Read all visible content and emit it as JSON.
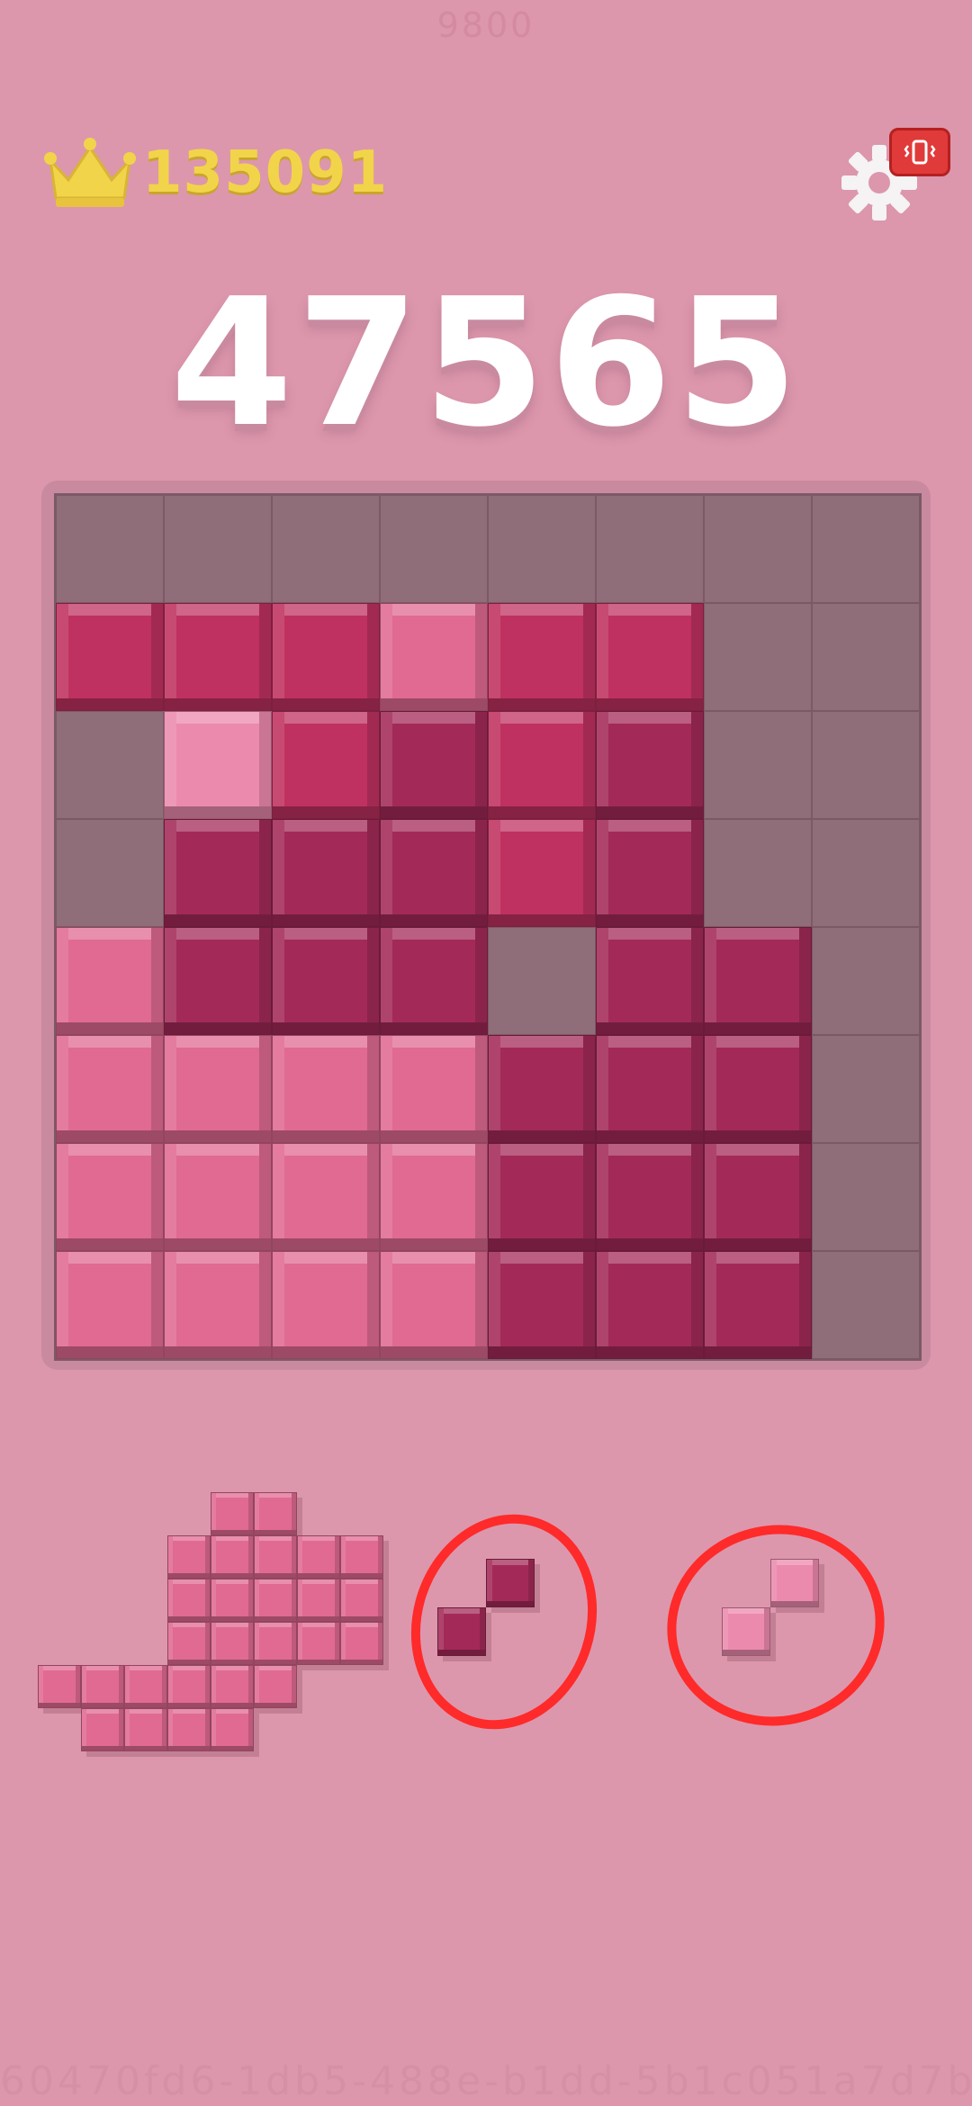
{
  "watermark": {
    "top": "9800",
    "bottom": "60470fd6-1db5-488e-b1dd-5b1c051a7d7b"
  },
  "header": {
    "best_score": "135091",
    "best_icon": "crown-icon",
    "settings_icon": "gear-icon",
    "vibration_icon": "vibration-icon"
  },
  "score": "47565",
  "colors": {
    "background": "#dc97ac",
    "empty": "#8f6e7a",
    "light": "#e06a92",
    "mid": "#bf3160",
    "dark": "#a32a58",
    "pale": "#ec8aad",
    "highlight_circle": "#ff2a2a"
  },
  "board": {
    "size": 8,
    "rows": [
      "........",
      "MMMLMM..",
      ".PMDMD..",
      ".DDDMD..",
      "LDDD.DD.",
      "LLLLDDD.",
      "LLLLDDD.",
      "LLLLDDD."
    ]
  },
  "pieces": [
    {
      "name": "big-piece",
      "color": "light",
      "cells": [
        [
          4,
          0
        ],
        [
          5,
          0
        ],
        [
          3,
          1
        ],
        [
          4,
          1
        ],
        [
          5,
          1
        ],
        [
          6,
          1
        ],
        [
          7,
          1
        ],
        [
          3,
          2
        ],
        [
          4,
          2
        ],
        [
          5,
          2
        ],
        [
          6,
          2
        ],
        [
          7,
          2
        ],
        [
          3,
          3
        ],
        [
          4,
          3
        ],
        [
          5,
          3
        ],
        [
          6,
          3
        ],
        [
          7,
          3
        ],
        [
          0,
          4
        ],
        [
          1,
          4
        ],
        [
          2,
          4
        ],
        [
          3,
          4
        ],
        [
          4,
          4
        ],
        [
          5,
          4
        ],
        [
          1,
          5
        ],
        [
          2,
          5
        ],
        [
          3,
          5
        ],
        [
          4,
          5
        ]
      ]
    },
    {
      "name": "diagonal-piece-dark",
      "color": "dark",
      "cells": [
        [
          1,
          0
        ],
        [
          0,
          1
        ]
      ],
      "circled": true
    },
    {
      "name": "diagonal-piece-pale",
      "color": "pale",
      "cells": [
        [
          1,
          0
        ],
        [
          0,
          1
        ]
      ],
      "circled": true
    }
  ]
}
